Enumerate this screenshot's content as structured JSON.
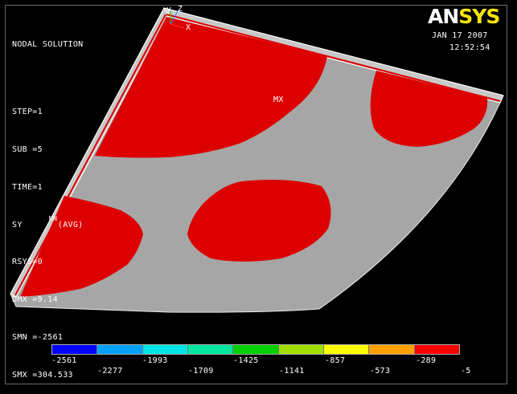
{
  "title": "NODAL SOLUTION",
  "info_lines": [
    "STEP=1",
    "SUB =5",
    "TIME=1",
    "SY       (AVG)",
    "RSYS=0",
    "DMX =9.14",
    "SMN =-2561",
    "SMX =304.533"
  ],
  "logo": {
    "an": "AN",
    "sys": "SYS"
  },
  "date": "JAN 17 2007",
  "time": "12:52:54",
  "markers": {
    "mx": "MX",
    "mn": "MN"
  },
  "triad": {
    "y": "Y",
    "z": "Z",
    "x": "X"
  },
  "legend": {
    "colors": [
      "#0000ff",
      "#00a0ff",
      "#00e6e6",
      "#00e6a0",
      "#00d000",
      "#a0e000",
      "#ffff00",
      "#ffa000",
      "#ff0000"
    ],
    "upper_labels": [
      "-2561",
      "-1993",
      "-1425",
      "-857",
      "-289"
    ],
    "lower_labels": [
      "-2277",
      "-1709",
      "-1141",
      "-573",
      "-5"
    ]
  },
  "model_colors": {
    "gray": "#a6a6a6",
    "red": "#dd0000",
    "edge": "#ffffff"
  }
}
